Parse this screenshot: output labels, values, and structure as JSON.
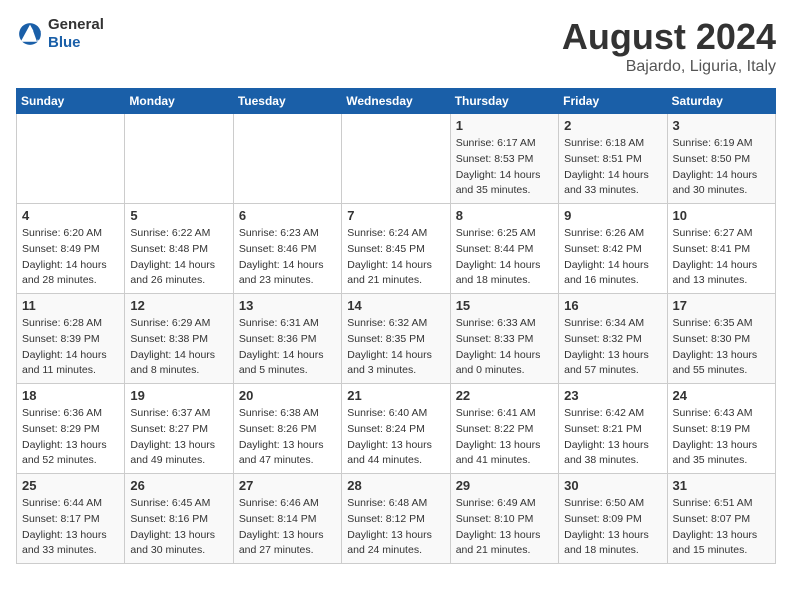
{
  "header": {
    "logo_general": "General",
    "logo_blue": "Blue",
    "title": "August 2024",
    "subtitle": "Bajardo, Liguria, Italy"
  },
  "weekdays": [
    "Sunday",
    "Monday",
    "Tuesday",
    "Wednesday",
    "Thursday",
    "Friday",
    "Saturday"
  ],
  "weeks": [
    [
      {
        "day": "",
        "info": ""
      },
      {
        "day": "",
        "info": ""
      },
      {
        "day": "",
        "info": ""
      },
      {
        "day": "",
        "info": ""
      },
      {
        "day": "1",
        "info": "Sunrise: 6:17 AM\nSunset: 8:53 PM\nDaylight: 14 hours\nand 35 minutes."
      },
      {
        "day": "2",
        "info": "Sunrise: 6:18 AM\nSunset: 8:51 PM\nDaylight: 14 hours\nand 33 minutes."
      },
      {
        "day": "3",
        "info": "Sunrise: 6:19 AM\nSunset: 8:50 PM\nDaylight: 14 hours\nand 30 minutes."
      }
    ],
    [
      {
        "day": "4",
        "info": "Sunrise: 6:20 AM\nSunset: 8:49 PM\nDaylight: 14 hours\nand 28 minutes."
      },
      {
        "day": "5",
        "info": "Sunrise: 6:22 AM\nSunset: 8:48 PM\nDaylight: 14 hours\nand 26 minutes."
      },
      {
        "day": "6",
        "info": "Sunrise: 6:23 AM\nSunset: 8:46 PM\nDaylight: 14 hours\nand 23 minutes."
      },
      {
        "day": "7",
        "info": "Sunrise: 6:24 AM\nSunset: 8:45 PM\nDaylight: 14 hours\nand 21 minutes."
      },
      {
        "day": "8",
        "info": "Sunrise: 6:25 AM\nSunset: 8:44 PM\nDaylight: 14 hours\nand 18 minutes."
      },
      {
        "day": "9",
        "info": "Sunrise: 6:26 AM\nSunset: 8:42 PM\nDaylight: 14 hours\nand 16 minutes."
      },
      {
        "day": "10",
        "info": "Sunrise: 6:27 AM\nSunset: 8:41 PM\nDaylight: 14 hours\nand 13 minutes."
      }
    ],
    [
      {
        "day": "11",
        "info": "Sunrise: 6:28 AM\nSunset: 8:39 PM\nDaylight: 14 hours\nand 11 minutes."
      },
      {
        "day": "12",
        "info": "Sunrise: 6:29 AM\nSunset: 8:38 PM\nDaylight: 14 hours\nand 8 minutes."
      },
      {
        "day": "13",
        "info": "Sunrise: 6:31 AM\nSunset: 8:36 PM\nDaylight: 14 hours\nand 5 minutes."
      },
      {
        "day": "14",
        "info": "Sunrise: 6:32 AM\nSunset: 8:35 PM\nDaylight: 14 hours\nand 3 minutes."
      },
      {
        "day": "15",
        "info": "Sunrise: 6:33 AM\nSunset: 8:33 PM\nDaylight: 14 hours\nand 0 minutes."
      },
      {
        "day": "16",
        "info": "Sunrise: 6:34 AM\nSunset: 8:32 PM\nDaylight: 13 hours\nand 57 minutes."
      },
      {
        "day": "17",
        "info": "Sunrise: 6:35 AM\nSunset: 8:30 PM\nDaylight: 13 hours\nand 55 minutes."
      }
    ],
    [
      {
        "day": "18",
        "info": "Sunrise: 6:36 AM\nSunset: 8:29 PM\nDaylight: 13 hours\nand 52 minutes."
      },
      {
        "day": "19",
        "info": "Sunrise: 6:37 AM\nSunset: 8:27 PM\nDaylight: 13 hours\nand 49 minutes."
      },
      {
        "day": "20",
        "info": "Sunrise: 6:38 AM\nSunset: 8:26 PM\nDaylight: 13 hours\nand 47 minutes."
      },
      {
        "day": "21",
        "info": "Sunrise: 6:40 AM\nSunset: 8:24 PM\nDaylight: 13 hours\nand 44 minutes."
      },
      {
        "day": "22",
        "info": "Sunrise: 6:41 AM\nSunset: 8:22 PM\nDaylight: 13 hours\nand 41 minutes."
      },
      {
        "day": "23",
        "info": "Sunrise: 6:42 AM\nSunset: 8:21 PM\nDaylight: 13 hours\nand 38 minutes."
      },
      {
        "day": "24",
        "info": "Sunrise: 6:43 AM\nSunset: 8:19 PM\nDaylight: 13 hours\nand 35 minutes."
      }
    ],
    [
      {
        "day": "25",
        "info": "Sunrise: 6:44 AM\nSunset: 8:17 PM\nDaylight: 13 hours\nand 33 minutes."
      },
      {
        "day": "26",
        "info": "Sunrise: 6:45 AM\nSunset: 8:16 PM\nDaylight: 13 hours\nand 30 minutes."
      },
      {
        "day": "27",
        "info": "Sunrise: 6:46 AM\nSunset: 8:14 PM\nDaylight: 13 hours\nand 27 minutes."
      },
      {
        "day": "28",
        "info": "Sunrise: 6:48 AM\nSunset: 8:12 PM\nDaylight: 13 hours\nand 24 minutes."
      },
      {
        "day": "29",
        "info": "Sunrise: 6:49 AM\nSunset: 8:10 PM\nDaylight: 13 hours\nand 21 minutes."
      },
      {
        "day": "30",
        "info": "Sunrise: 6:50 AM\nSunset: 8:09 PM\nDaylight: 13 hours\nand 18 minutes."
      },
      {
        "day": "31",
        "info": "Sunrise: 6:51 AM\nSunset: 8:07 PM\nDaylight: 13 hours\nand 15 minutes."
      }
    ]
  ]
}
